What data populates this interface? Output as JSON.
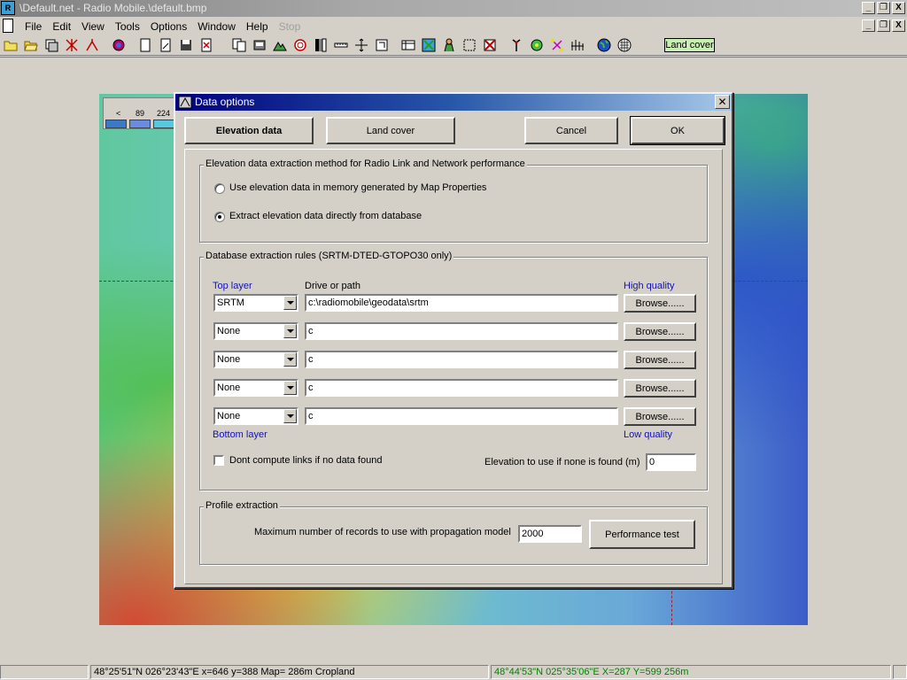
{
  "window": {
    "title": "\\Default.net - Radio Mobile.\\default.bmp",
    "buttons": [
      "_",
      "❐",
      "X"
    ]
  },
  "menu": {
    "items": [
      "File",
      "Edit",
      "View",
      "Tools",
      "Options",
      "Window",
      "Help",
      "Stop"
    ],
    "mdi_buttons": [
      "_",
      "❐",
      "X"
    ]
  },
  "toolbar": {
    "icons": [
      "new-folder-icon",
      "open-folder-icon",
      "stack-icon",
      "network-icon",
      "link-edit-icon",
      "radio-link-icon",
      "page-icon",
      "page-edit-icon",
      "save-icon",
      "print-icon",
      "copy-icon",
      "merge-icon",
      "terrain-icon",
      "target-icon",
      "grayscale-icon",
      "ruler-icon",
      "pan-icon",
      "zoom-icon",
      "table-icon",
      "map-select-icon",
      "person-icon",
      "select-region-icon",
      "delete-region-icon",
      "antenna-icon",
      "globe-icon",
      "network-tree-icon",
      "signal-icon",
      "world-icon",
      "grid-icon"
    ],
    "land_cover_label": "Land cover"
  },
  "map": {
    "legend": {
      "prev": "<",
      "values": [
        "89",
        "224"
      ],
      "colors": [
        "#3a78c8",
        "#6a8ce0",
        "#58c8e0"
      ]
    }
  },
  "dialog": {
    "title": "Data options",
    "tabs": {
      "elevation": "Elevation data",
      "land_cover": "Land cover"
    },
    "cancel": "Cancel",
    "ok": "OK",
    "method_group": {
      "legend": "Elevation data extraction method for Radio Link and Network performance",
      "options": [
        {
          "label": "Use elevation data in memory generated by Map Properties",
          "checked": false
        },
        {
          "label": "Extract elevation data directly from database",
          "checked": true
        }
      ]
    },
    "rules_group": {
      "legend": "Database extraction rules (SRTM-DTED-GTOPO30 only)",
      "top_layer": "Top layer",
      "drive_or_path": "Drive or path",
      "high_quality": "High quality",
      "bottom_layer": "Bottom layer",
      "low_quality": "Low quality",
      "browse": "Browse......",
      "rows": [
        {
          "layer": "SRTM",
          "path": "c:\\radiomobile\\geodata\\srtm"
        },
        {
          "layer": "None",
          "path": "c"
        },
        {
          "layer": "None",
          "path": "c"
        },
        {
          "layer": "None",
          "path": "c"
        },
        {
          "layer": "None",
          "path": "c"
        }
      ],
      "dont_compute_label": "Dont compute links if no data found",
      "dont_compute_checked": false,
      "elevation_default_label": "Elevation to use if none is found (m)",
      "elevation_default_value": "0"
    },
    "profile_group": {
      "legend": "Profile extraction",
      "max_records_label": "Maximum number of records to use with propagation model",
      "max_records_value": "2000",
      "performance_test": "Performance test"
    }
  },
  "statusbar": {
    "left": "48°25'51\"N  026°23'43\"E   x=646 y=388 Map= 286m Cropland",
    "right": "48°44'53\"N 025°35'06\"E  X=287 Y=599 256m",
    "right_color": "#008000"
  }
}
